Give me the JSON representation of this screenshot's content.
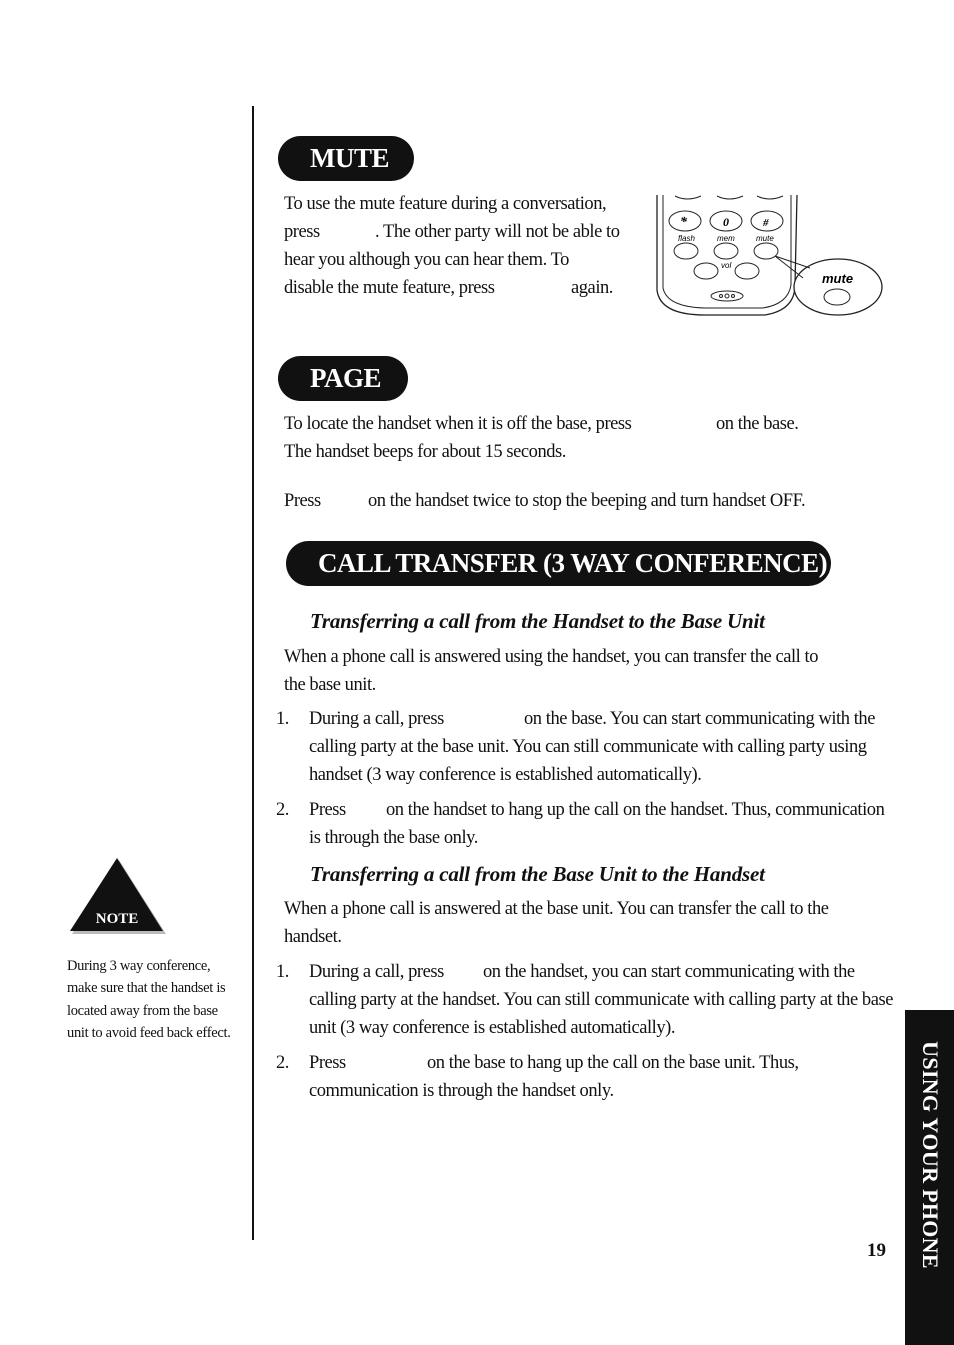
{
  "mute": {
    "heading": "MUTE",
    "lines": [
      "To use the mute feature during a conversation,",
      "press",
      ". The other party will not be able to",
      "hear you although you can hear them. To",
      "disable the mute feature, press",
      "again."
    ],
    "illustration": {
      "keys": [
        "*",
        "0",
        "#"
      ],
      "labels": [
        "flash",
        "mem",
        "mute",
        "vol"
      ],
      "callout": "mute"
    }
  },
  "page": {
    "heading": "PAGE",
    "lines": [
      "To locate the handset when it is off the base, press",
      "on the base.",
      "The handset beeps for about 15 seconds.",
      "Press",
      "on the handset twice to stop the beeping and turn handset OFF."
    ]
  },
  "transfer": {
    "heading": "CALL TRANSFER (3 WAY CONFERENCE)",
    "sub1": "Transferring a call from the Handset to the Base Unit",
    "intro1": [
      "When a phone call is answered using the handset, you can transfer the call to",
      "the base unit."
    ],
    "steps1": [
      {
        "num": "1.",
        "lines": [
          "During a call, press",
          "on the base. You can start communicating with the",
          "calling party at the base unit. You can still communicate with calling party using",
          "handset (3 way conference is established automatically)."
        ]
      },
      {
        "num": "2.",
        "lines": [
          "Press",
          "on the handset to hang up the call on the handset. Thus, communication",
          "is through the base only."
        ]
      }
    ],
    "sub2": "Transferring a call from the Base Unit to the Handset",
    "intro2": [
      "When a phone call is answered at the base unit. You can transfer the call to the",
      "handset."
    ],
    "steps2": [
      {
        "num": "1.",
        "lines": [
          "During a call, press",
          "on the handset, you can start communicating with the",
          "calling party at the handset. You can still communicate with calling party at the base",
          "unit (3 way conference is established automatically)."
        ]
      },
      {
        "num": "2.",
        "lines": [
          "Press",
          "on the base to hang up the call on the base unit. Thus,",
          "communication is through the handset only."
        ]
      }
    ]
  },
  "note": {
    "label": "NOTE",
    "lines": [
      "During 3 way conference,",
      "make sure that the handset is",
      "located away from the base",
      "unit to avoid feed back effect."
    ]
  },
  "side_tab": "USING YOUR PHONE",
  "page_number": "19"
}
